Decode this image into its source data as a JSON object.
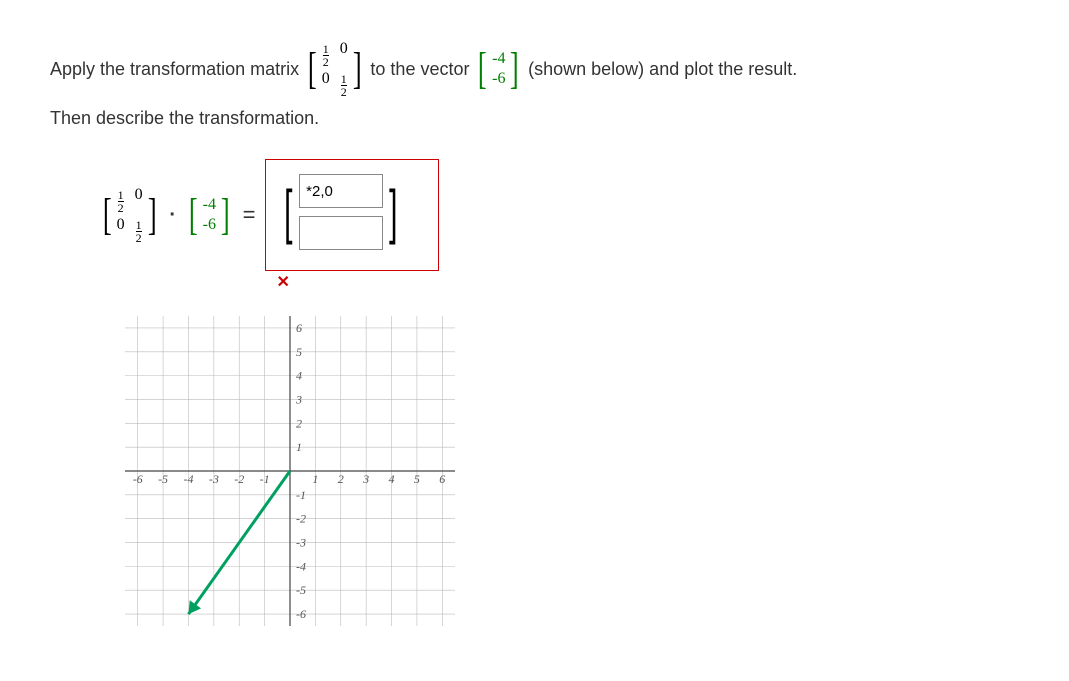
{
  "question": {
    "part1": "Apply the transformation matrix",
    "matrixA": [
      [
        "1/2",
        "0"
      ],
      [
        "0",
        "1/2"
      ]
    ],
    "part2": "to the vector",
    "vectorV": [
      "-4",
      "-6"
    ],
    "part3": "(shown below) and plot the result.",
    "line2": "Then describe the transformation."
  },
  "equation": {
    "matrixA": [
      [
        "1/2",
        "0"
      ],
      [
        "0",
        "1/2"
      ]
    ],
    "dot": "·",
    "vectorV": [
      "-4",
      "-6"
    ],
    "equals": "=",
    "input1_value": "*2,0",
    "input2_value": "",
    "feedback": "✕"
  },
  "chart_data": {
    "type": "scatter",
    "xlim": [
      -6.5,
      6.5
    ],
    "ylim": [
      -6.5,
      6.5
    ],
    "xticks": [
      -6,
      -5,
      -4,
      -3,
      -2,
      -1,
      1,
      2,
      3,
      4,
      5,
      6
    ],
    "yticks": [
      -6,
      -5,
      -4,
      -3,
      -2,
      -1,
      1,
      2,
      3,
      4,
      5,
      6
    ],
    "vector": {
      "from": [
        0,
        0
      ],
      "to": [
        -4,
        -6
      ],
      "color": "#00a060"
    }
  }
}
